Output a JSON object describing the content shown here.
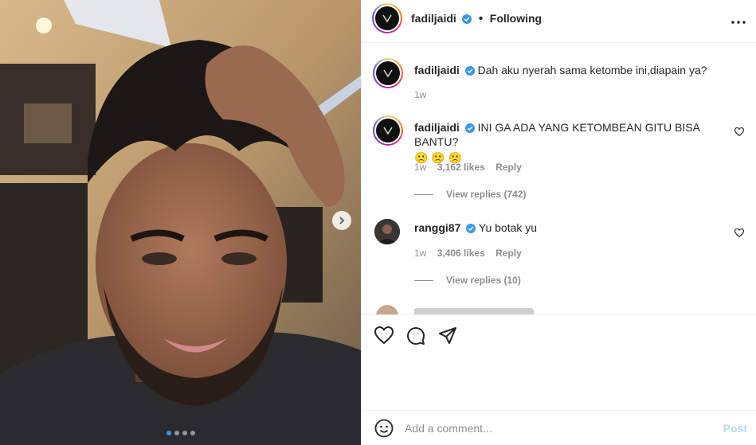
{
  "post": {
    "author": "fadiljaidi",
    "separator": "•",
    "follow_status": "Following"
  },
  "comments": [
    {
      "username": "fadiljaidi",
      "text": "Dah aku nyerah sama ketombe ini,diapain ya?",
      "time": "1w"
    },
    {
      "username": "fadiljaidi",
      "text": "INI GA ADA YANG KETOMBEAN GITU BISA BANTU?",
      "emoji": "🙁 🙁 🙁",
      "time": "1w",
      "likes": "3,162 likes",
      "reply_label": "Reply",
      "view_replies": "View replies (742)"
    },
    {
      "username": "ranggi87",
      "text": "Yu botak yu",
      "time": "1w",
      "likes": "3,406 likes",
      "reply_label": "Reply",
      "view_replies": "View replies (10)"
    }
  ],
  "composer": {
    "placeholder": "Add a comment...",
    "post_label": "Post"
  },
  "icons": [
    "verified-badge-icon",
    "more-options-icon",
    "heart-icon",
    "comment-icon",
    "share-icon",
    "emoji-icon",
    "chevron-right-icon"
  ],
  "carousel": {
    "total": 4,
    "current": 1
  },
  "colors": {
    "verified": "#3897f0",
    "post_disabled": "#b3dbff",
    "muted": "#8e8e8e"
  }
}
